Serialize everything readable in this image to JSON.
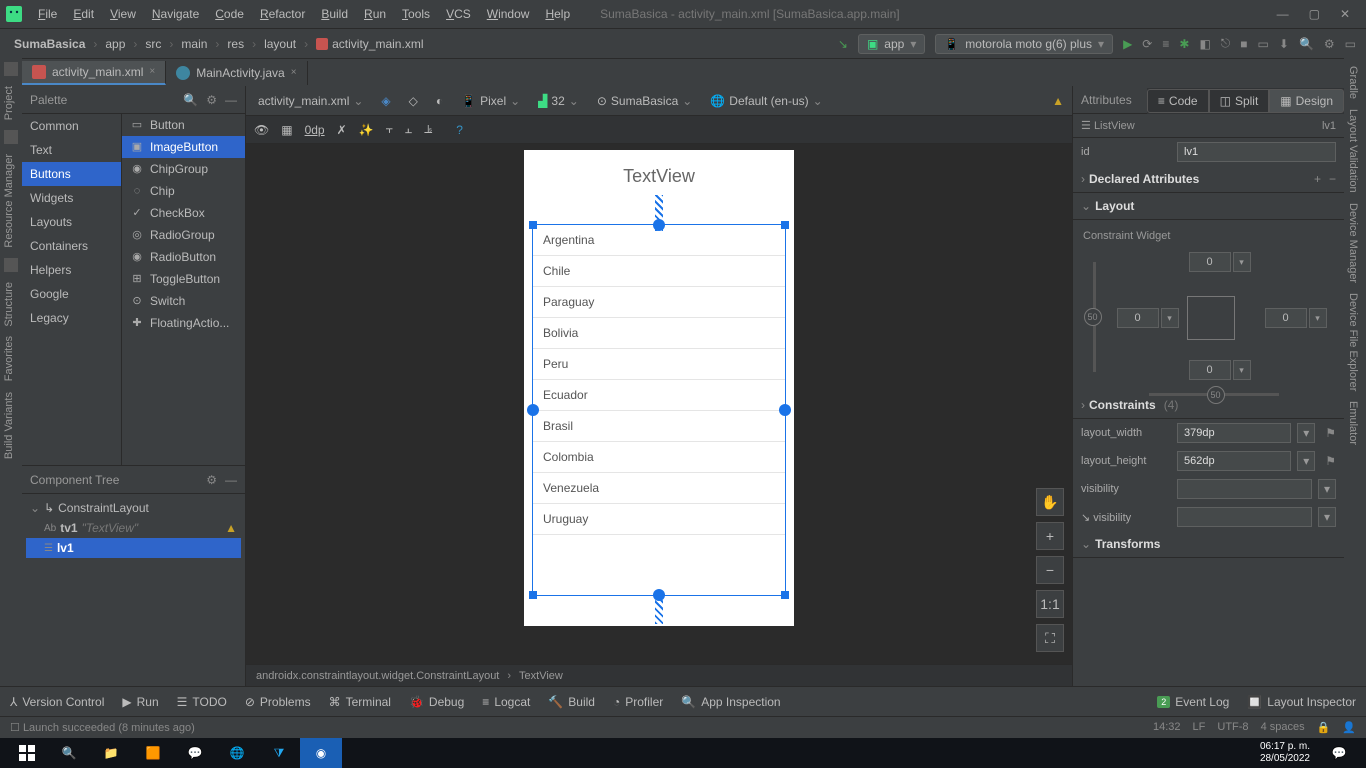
{
  "menus": [
    "File",
    "Edit",
    "View",
    "Navigate",
    "Code",
    "Refactor",
    "Build",
    "Run",
    "Tools",
    "VCS",
    "Window",
    "Help"
  ],
  "window_title": "SumaBasica - activity_main.xml [SumaBasica.app.main]",
  "breadcrumb": [
    "SumaBasica",
    "app",
    "src",
    "main",
    "res",
    "layout",
    "activity_main.xml"
  ],
  "run_config": "app",
  "device": "motorola moto g(6) plus",
  "tabs": [
    {
      "name": "activity_main.xml",
      "active": true,
      "kind": "xml"
    },
    {
      "name": "MainActivity.java",
      "active": false,
      "kind": "java"
    }
  ],
  "viewmodes": {
    "code": "Code",
    "split": "Split",
    "design": "Design"
  },
  "palette": {
    "title": "Palette",
    "categories": [
      "Common",
      "Text",
      "Buttons",
      "Widgets",
      "Layouts",
      "Containers",
      "Helpers",
      "Google",
      "Legacy"
    ],
    "selected_cat": "Buttons",
    "items": [
      "Button",
      "ImageButton",
      "ChipGroup",
      "Chip",
      "CheckBox",
      "RadioGroup",
      "RadioButton",
      "ToggleButton",
      "Switch",
      "FloatingActio..."
    ],
    "selected_item": "ImageButton"
  },
  "component_tree": {
    "title": "Component Tree",
    "root": "ConstraintLayout",
    "children": [
      {
        "id": "tv1",
        "hint": "\"TextView\"",
        "kind": "Ab",
        "warn": true
      },
      {
        "id": "lv1",
        "kind": "list",
        "selected": true
      }
    ]
  },
  "designer_bar": {
    "file": "activity_main.xml",
    "device": "Pixel",
    "api_icon": "32",
    "theme": "SumaBasica",
    "locale": "Default (en-us)"
  },
  "designer_bar2": {
    "margin": "0dp"
  },
  "preview": {
    "textview": "TextView",
    "list": [
      "Argentina",
      "Chile",
      "Paraguay",
      "Bolivia",
      "Peru",
      "Ecuador",
      "Brasil",
      "Colombia",
      "Venezuela",
      "Uruguay"
    ]
  },
  "zoom": [
    "✋",
    "+",
    "−",
    "1:1",
    "⛶"
  ],
  "attributes": {
    "title": "Attributes",
    "type": "ListView",
    "varname": "lv1",
    "id_label": "id",
    "id_value": "lv1",
    "sections": {
      "declared": "Declared Attributes",
      "layout": "Layout",
      "constraint_label": "Constraint Widget",
      "constraints": "Constraints",
      "constraints_count": "(4)",
      "transforms": "Transforms"
    },
    "constraint_vals": {
      "top": "0",
      "left": "0",
      "right": "0",
      "bottom": "0",
      "bias_left": "50",
      "bias_bottom": "50"
    },
    "fields": [
      {
        "label": "layout_width",
        "value": "379dp",
        "drop": true,
        "flag": true
      },
      {
        "label": "layout_height",
        "value": "562dp",
        "drop": true,
        "flag": true
      },
      {
        "label": "visibility",
        "value": "",
        "drop": true
      },
      {
        "label": "visibility",
        "value": "",
        "drop": true,
        "icon": "↘"
      }
    ]
  },
  "xml_breadcrumb": [
    "androidx.constraintlayout.widget.ConstraintLayout",
    "TextView"
  ],
  "bottom_tools": [
    "Version Control",
    "Run",
    "TODO",
    "Problems",
    "Terminal",
    "Debug",
    "Logcat",
    "Build",
    "Profiler",
    "App Inspection"
  ],
  "bottom_right": {
    "events": "Event Log",
    "events_badge": "2",
    "layout_insp": "Layout Inspector"
  },
  "status": {
    "msg": "Launch succeeded (8 minutes ago)",
    "time": "14:32",
    "enc": "LF",
    "charset": "UTF-8",
    "indent": "4 spaces"
  },
  "side_left": [
    "Project",
    "Resource Manager",
    "Structure",
    "Favorites",
    "Build Variants"
  ],
  "side_right": [
    "Gradle",
    "Layout Validation",
    "Device Manager",
    "Device File Explorer",
    "Emulator"
  ],
  "taskbar": {
    "time": "06:17 p. m.",
    "date": "28/05/2022"
  }
}
